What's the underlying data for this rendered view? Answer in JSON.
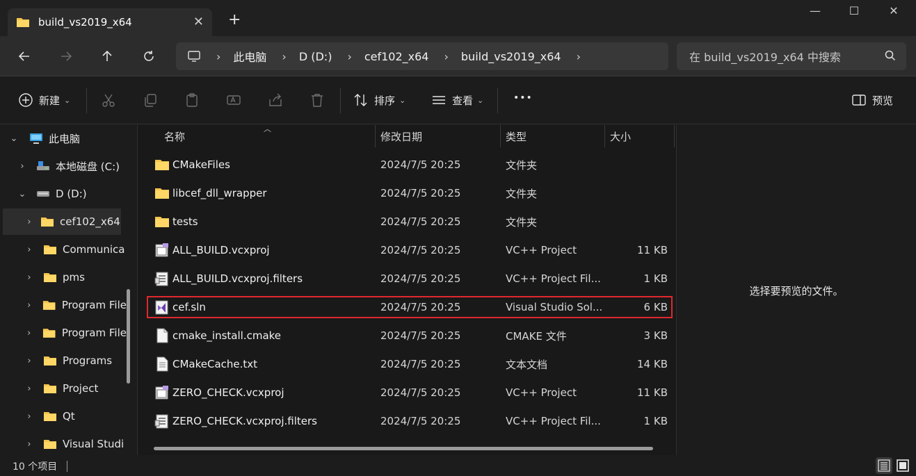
{
  "window": {
    "tab_title": "build_vs2019_x64",
    "tab_close": "✕",
    "new_tab": "+",
    "minimize": "—",
    "maximize": "☐",
    "close": "✕"
  },
  "address": {
    "crumbs": [
      "此电脑",
      "D (D:)",
      "cef102_x64",
      "build_vs2019_x64"
    ],
    "search_placeholder": "在 build_vs2019_x64 中搜索"
  },
  "toolbar": {
    "new_label": "新建",
    "sort_label": "排序",
    "view_label": "查看",
    "more_label": "•••",
    "preview_label": "预览"
  },
  "sidebar": {
    "items": [
      {
        "label": "此电脑",
        "icon": "computer-icon",
        "expanded": true
      },
      {
        "label": "本地磁盘 (C:)",
        "icon": "drive-c-icon",
        "expanded": false
      },
      {
        "label": "D (D:)",
        "icon": "drive-icon",
        "expanded": true
      },
      {
        "label": "cef102_x64",
        "icon": "folder-icon",
        "selected": true
      },
      {
        "label": "Communica",
        "icon": "folder-icon"
      },
      {
        "label": "pms",
        "icon": "folder-icon"
      },
      {
        "label": "Program File",
        "icon": "folder-icon"
      },
      {
        "label": "Program File",
        "icon": "folder-icon"
      },
      {
        "label": "Programs",
        "icon": "folder-icon"
      },
      {
        "label": "Project",
        "icon": "folder-icon"
      },
      {
        "label": "Qt",
        "icon": "folder-icon"
      },
      {
        "label": "Visual Studi",
        "icon": "folder-icon"
      }
    ]
  },
  "filelist": {
    "columns": [
      "名称",
      "修改日期",
      "类型",
      "大小"
    ],
    "rows": [
      {
        "name": "CMakeFiles",
        "date": "2024/7/5 20:25",
        "type": "文件夹",
        "size": "",
        "icon": "folder-icon"
      },
      {
        "name": "libcef_dll_wrapper",
        "date": "2024/7/5 20:25",
        "type": "文件夹",
        "size": "",
        "icon": "folder-icon"
      },
      {
        "name": "tests",
        "date": "2024/7/5 20:25",
        "type": "文件夹",
        "size": "",
        "icon": "folder-icon"
      },
      {
        "name": "ALL_BUILD.vcxproj",
        "date": "2024/7/5 20:25",
        "type": "VC++ Project",
        "size": "11 KB",
        "icon": "vcxproj-icon"
      },
      {
        "name": "ALL_BUILD.vcxproj.filters",
        "date": "2024/7/5 20:25",
        "type": "VC++ Project Fil...",
        "size": "1 KB",
        "icon": "vcxproj-filters-icon"
      },
      {
        "name": "cef.sln",
        "date": "2024/7/5 20:25",
        "type": "Visual Studio Sol...",
        "size": "6 KB",
        "icon": "visual-studio-solution-icon"
      },
      {
        "name": "cmake_install.cmake",
        "date": "2024/7/5 20:25",
        "type": "CMAKE 文件",
        "size": "3 KB",
        "icon": "file-icon"
      },
      {
        "name": "CMakeCache.txt",
        "date": "2024/7/5 20:25",
        "type": "文本文档",
        "size": "14 KB",
        "icon": "text-file-icon"
      },
      {
        "name": "ZERO_CHECK.vcxproj",
        "date": "2024/7/5 20:25",
        "type": "VC++ Project",
        "size": "11 KB",
        "icon": "vcxproj-icon"
      },
      {
        "name": "ZERO_CHECK.vcxproj.filters",
        "date": "2024/7/5 20:25",
        "type": "VC++ Project Fil...",
        "size": "1 KB",
        "icon": "vcxproj-filters-icon"
      }
    ]
  },
  "preview": {
    "empty_text": "选择要预览的文件。"
  },
  "status": {
    "item_count": "10 个项目"
  },
  "colors": {
    "folder": "#f4c44e",
    "highlight_border": "#e0282e",
    "vs_purple": "#865fc5"
  }
}
